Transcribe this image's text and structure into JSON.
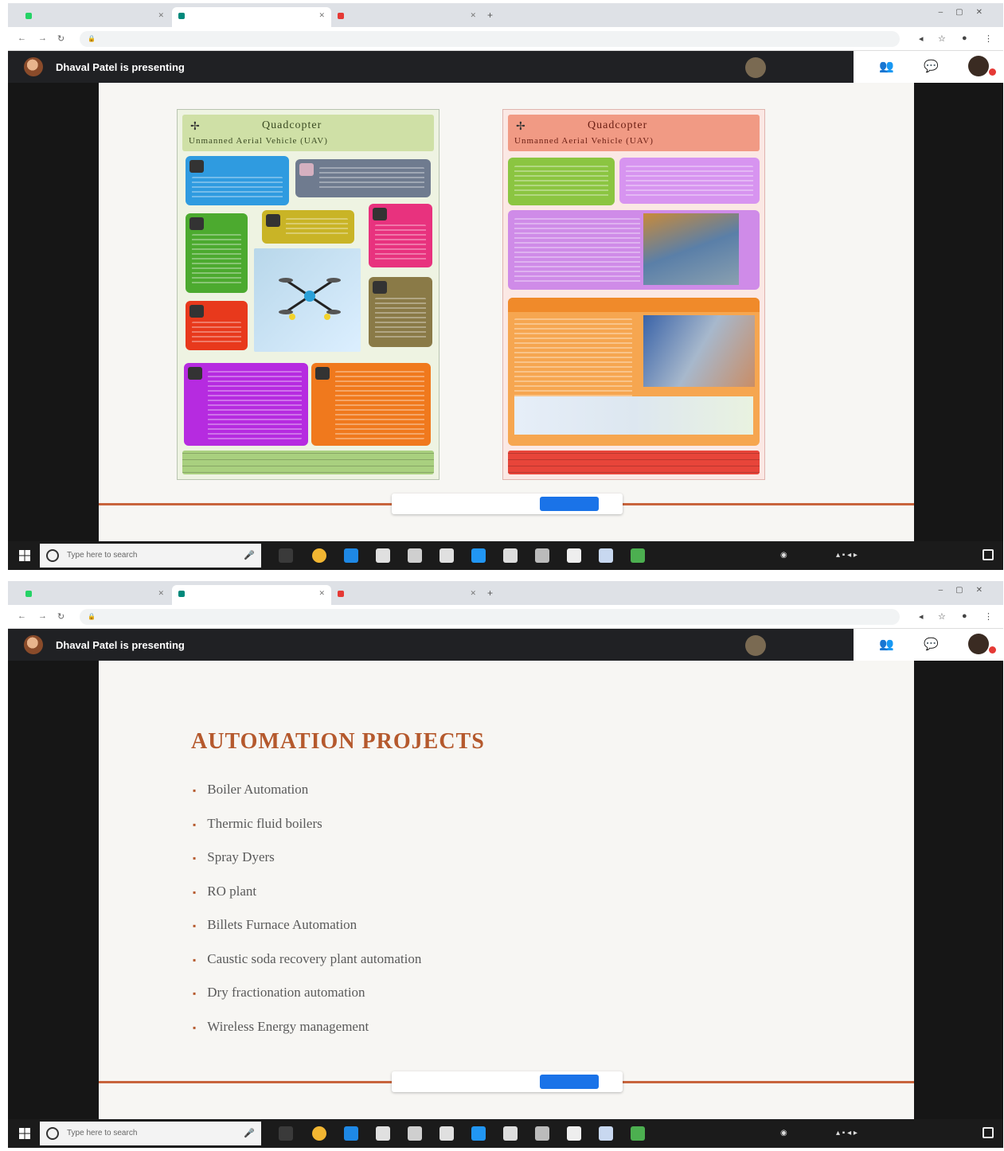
{
  "screens": [
    {
      "browser": {
        "tabs": [
          "",
          "",
          ""
        ],
        "url": ""
      },
      "meet": {
        "presenting_text": "Dhaval Patel is presenting",
        "participant_name": "",
        "participant_more": ""
      },
      "slide": {
        "posters": [
          {
            "header_line1": "Quadcopter",
            "header_line2": "Unmanned Aerial Vehicle (UAV)"
          },
          {
            "header_line1": "Quadcopter",
            "header_line2": "Unmanned Aerial Vehicle (UAV)"
          }
        ]
      },
      "share_bar": {
        "message": "",
        "stop_label": "",
        "hide_label": ""
      },
      "taskbar": {
        "search_placeholder": "Type here to search",
        "time": "",
        "date": ""
      }
    },
    {
      "browser": {
        "tabs": [
          "",
          "",
          ""
        ],
        "url": ""
      },
      "meet": {
        "presenting_text": "Dhaval Patel is presenting",
        "participant_name": "",
        "participant_more": ""
      },
      "slide": {
        "title": "AUTOMATION PROJECTS",
        "bullets": [
          "Boiler Automation",
          "Thermic fluid boilers",
          "Spray Dyers",
          "RO plant",
          "Billets Furnace Automation",
          "Caustic soda recovery plant automation",
          "Dry fractionation automation",
          "Wireless Energy management"
        ]
      },
      "share_bar": {
        "message": "",
        "stop_label": "",
        "hide_label": ""
      },
      "taskbar": {
        "search_placeholder": "Type here to search",
        "time": "",
        "date": ""
      }
    }
  ],
  "colors": {
    "meet_bar": "#202124",
    "accent_orange": "#b5592d",
    "stop_button": "#1a73e8",
    "poster1_header": "#cfe0a6",
    "poster2_header": "#f19a84"
  },
  "icons": [
    "windows-logo-icon",
    "search-icon",
    "microphone-icon",
    "chrome-icon",
    "edge-icon",
    "mail-icon",
    "store-icon",
    "dropbox-icon",
    "present-icon",
    "chat-icon",
    "people-icon"
  ]
}
